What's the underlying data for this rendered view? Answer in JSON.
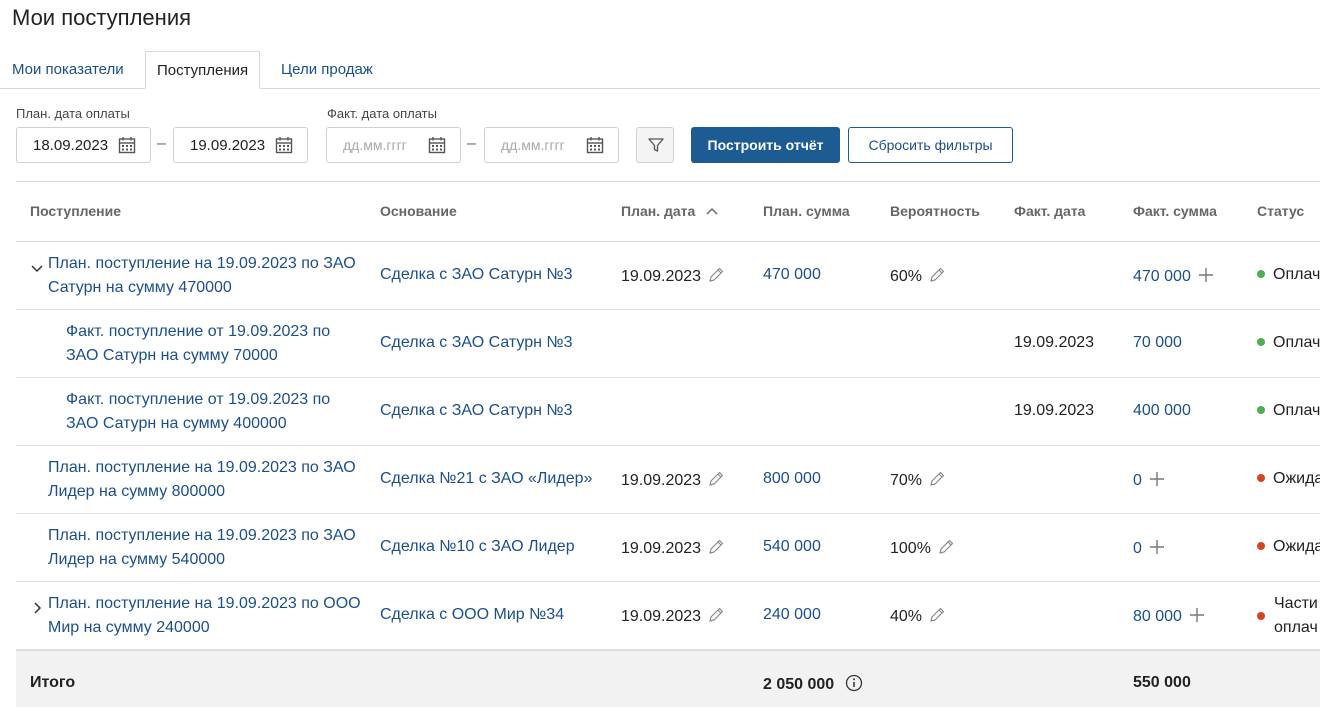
{
  "page": {
    "title": "Мои поступления"
  },
  "tabs": [
    {
      "label": "Мои показатели",
      "active": false
    },
    {
      "label": "Поступления",
      "active": true
    },
    {
      "label": "Цели продаж",
      "active": false
    }
  ],
  "filters": {
    "plan_label": "План. дата оплаты",
    "fact_label": "Факт. дата оплаты",
    "plan_from": "18.09.2023",
    "plan_to": "19.09.2023",
    "fact_from_placeholder": "дд.мм.гггг",
    "fact_to_placeholder": "дд.мм.гггг",
    "dash": "–",
    "build_label": "Построить отчёт",
    "reset_label": "Сбросить фильтры"
  },
  "table": {
    "columns": [
      "Поступление",
      "Основание",
      "План. дата",
      "План. сумма",
      "Вероятность",
      "Факт. дата",
      "Факт. сумма",
      "Статус"
    ],
    "rows": [
      {
        "title1": "План. поступление на 19.09.2023 по ЗАО",
        "title2": "Сатурн на сумму 470000",
        "basis": "Сделка с ЗАО Сатурн №3",
        "plan_date": "19.09.2023",
        "plan_sum": "470 000",
        "probability": "60%",
        "fact_date": "",
        "fact_sum": "470 000",
        "status1": "Оплач",
        "status2": "",
        "status_color": "#4caf50",
        "expander": "expanded",
        "level": 0,
        "editable": true
      },
      {
        "title1": "Факт. поступление от 19.09.2023 по",
        "title2": "ЗАО Сатурн на сумму 70000",
        "basis": "Сделка с ЗАО Сатурн №3",
        "plan_date": "",
        "plan_sum": "",
        "probability": "",
        "fact_date": "19.09.2023",
        "fact_sum": "70 000",
        "status1": "Оплач",
        "status2": "",
        "status_color": "#4caf50",
        "expander": "none",
        "level": 1,
        "editable": false
      },
      {
        "title1": "Факт. поступление от 19.09.2023 по",
        "title2": "ЗАО Сатурн на сумму 400000",
        "basis": "Сделка с ЗАО Сатурн №3",
        "plan_date": "",
        "plan_sum": "",
        "probability": "",
        "fact_date": "19.09.2023",
        "fact_sum": "400 000",
        "status1": "Оплач",
        "status2": "",
        "status_color": "#4caf50",
        "expander": "none",
        "level": 1,
        "editable": false
      },
      {
        "title1": "План. поступление на 19.09.2023 по ЗАО",
        "title2": "Лидер на сумму 800000",
        "basis": "Сделка №21 с ЗАО «Лидер»",
        "plan_date": "19.09.2023",
        "plan_sum": "800 000",
        "probability": "70%",
        "fact_date": "",
        "fact_sum": "0",
        "status1": "Ожида",
        "status2": "",
        "status_color": "#d9431e",
        "expander": "none",
        "level": 0,
        "editable": true
      },
      {
        "title1": "План. поступление на 19.09.2023 по ЗАО",
        "title2": "Лидер на сумму 540000",
        "basis": "Сделка №10 с ЗАО Лидер",
        "plan_date": "19.09.2023",
        "plan_sum": "540 000",
        "probability": "100%",
        "fact_date": "",
        "fact_sum": "0",
        "status1": "Ожида",
        "status2": "",
        "status_color": "#d9431e",
        "expander": "none",
        "level": 0,
        "editable": true
      },
      {
        "title1": "План. поступление на 19.09.2023 по ООО",
        "title2": "Мир на сумму 240000",
        "basis": "Сделка с ООО Мир №34",
        "plan_date": "19.09.2023",
        "plan_sum": "240 000",
        "probability": "40%",
        "fact_date": "",
        "fact_sum": "80 000",
        "status1": "Части",
        "status2": "оплач",
        "status_color": "#d9431e",
        "expander": "collapsed",
        "level": 0,
        "editable": true
      }
    ],
    "totals": {
      "label": "Итого",
      "plan_sum": "2 050 000",
      "fact_sum": "550 000"
    }
  }
}
